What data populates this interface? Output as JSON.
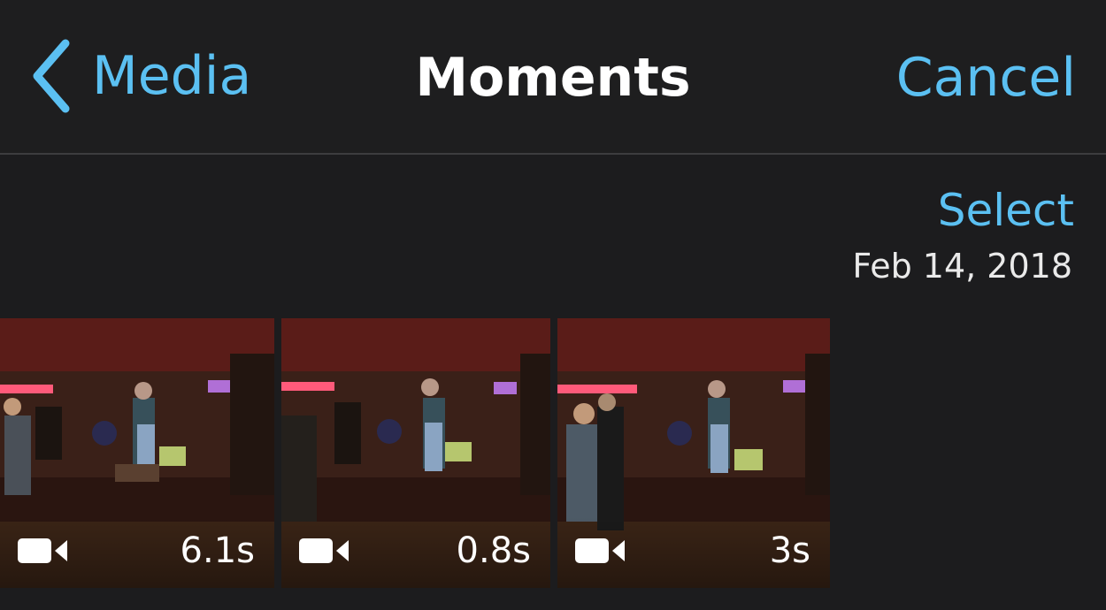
{
  "navbar": {
    "back_label": "Media",
    "title": "Moments",
    "cancel_label": "Cancel"
  },
  "section": {
    "select_label": "Select",
    "date": "Feb 14, 2018"
  },
  "videos": [
    {
      "duration": "6.1s",
      "icon": "video-camera-icon"
    },
    {
      "duration": "0.8s",
      "icon": "video-camera-icon"
    },
    {
      "duration": "3s",
      "icon": "video-camera-icon"
    }
  ],
  "colors": {
    "accent": "#5bc0f2",
    "background": "#1c1c1e",
    "navbar": "#1e1e1f",
    "title": "#ffffff"
  }
}
